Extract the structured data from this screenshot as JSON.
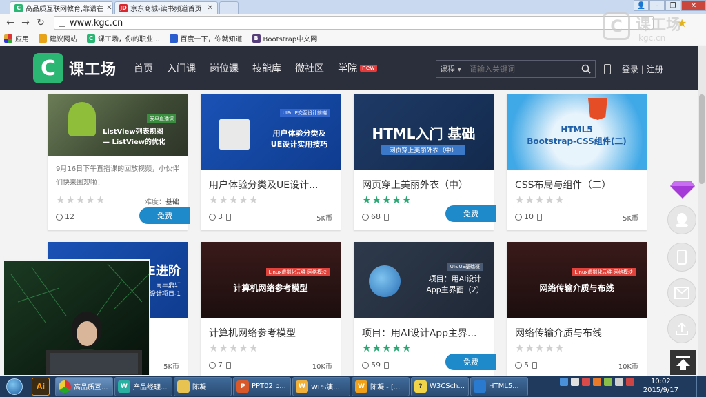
{
  "browser": {
    "tabs": [
      {
        "label": "高品质互联网教育,靠谱在",
        "active": true,
        "favicon": "C"
      },
      {
        "label": "京东商城-读书频道首页",
        "active": false,
        "favicon": "JD"
      }
    ],
    "url": "www.kgc.cn",
    "bookmarks": [
      {
        "label": "应用",
        "icon": "apps-icon"
      },
      {
        "label": "建议网站",
        "icon": "bookmark-icon"
      },
      {
        "label": "课工场，你的职业...",
        "icon": "C"
      },
      {
        "label": "百度一下，你就知道",
        "icon": "baidu-icon"
      },
      {
        "label": "Bootstrap中文网",
        "icon": "B"
      }
    ]
  },
  "watermark": {
    "name": "课工场",
    "url": "kgc.cn"
  },
  "site": {
    "logo_text": "课工场",
    "nav": [
      "首页",
      "入门课",
      "岗位课",
      "技能库",
      "微社区",
      "学院"
    ],
    "nav_badge": "new",
    "search_category": "课程",
    "search_placeholder": "请输入关键词",
    "login": "登录",
    "sep": "|",
    "register": "注册"
  },
  "cards": [
    {
      "tag": "安卓直播课",
      "headline": "ListView列表视图\n— ListView的优化",
      "desc": "9月16日下午直播课的回放视频，小伙伴们快来围观啦！",
      "level_label": "难度：",
      "level": "基础",
      "rating": 0,
      "count": "12",
      "button": "免费"
    },
    {
      "tag": "UI&UE交互设计前端",
      "headline": "用户体验分类及\nUE设计实用技巧",
      "title": "用户体验分类及UE设计...",
      "rating": 0,
      "count": "3",
      "price": "5K币"
    },
    {
      "tag": "",
      "headline": "HTML入门 基础",
      "subheadline": "网页穿上美丽外衣（中）",
      "title": "网页穿上美丽外衣（中）",
      "rating": 5,
      "count": "68",
      "button": "免费"
    },
    {
      "tag": "",
      "headline": "HTML5\nBootstrap-CSS组件(二)",
      "title": "CSS布局与组件（二）",
      "rating": 0,
      "count": "10",
      "price": "5K币"
    },
    {
      "tag": "",
      "headline": "UE进阶",
      "subheadline": "南丰鼎轩\n设计项目-1",
      "title": "",
      "rating": 0,
      "count": "",
      "price": "5K币"
    },
    {
      "tag": "Linux虚拟化云维-网络模块",
      "headline": "计算机网络参考模型",
      "title": "计算机网络参考模型",
      "rating": 0,
      "count": "7",
      "price": "10K币"
    },
    {
      "tag": "UI&UE基础班",
      "headline": "项目：用AI设计\nApp主界面（2）",
      "title": "项目：用AI设计App主界...",
      "rating": 5,
      "count": "59",
      "button": "免费"
    },
    {
      "tag": "Linux虚拟化云维-网络模块",
      "headline": "网络传输介质与布线",
      "title": "网络传输介质与布线",
      "rating": 0,
      "count": "5",
      "price": "10K币"
    }
  ],
  "taskbar": {
    "items": [
      "高品质互...",
      "产品经理...",
      "陈凝",
      "PPT02.p...",
      "WPS演...",
      "陈凝 - [...",
      "W3CSch...",
      "HTML5..."
    ],
    "time": "10:02",
    "date": "2015/9/17"
  },
  "colors": {
    "brand_green": "#2bb673",
    "header_bg": "#2b2e3b",
    "free_button": "#1f8ac9",
    "star_on": "#2aa873",
    "star_off": "#cfcfcf"
  }
}
